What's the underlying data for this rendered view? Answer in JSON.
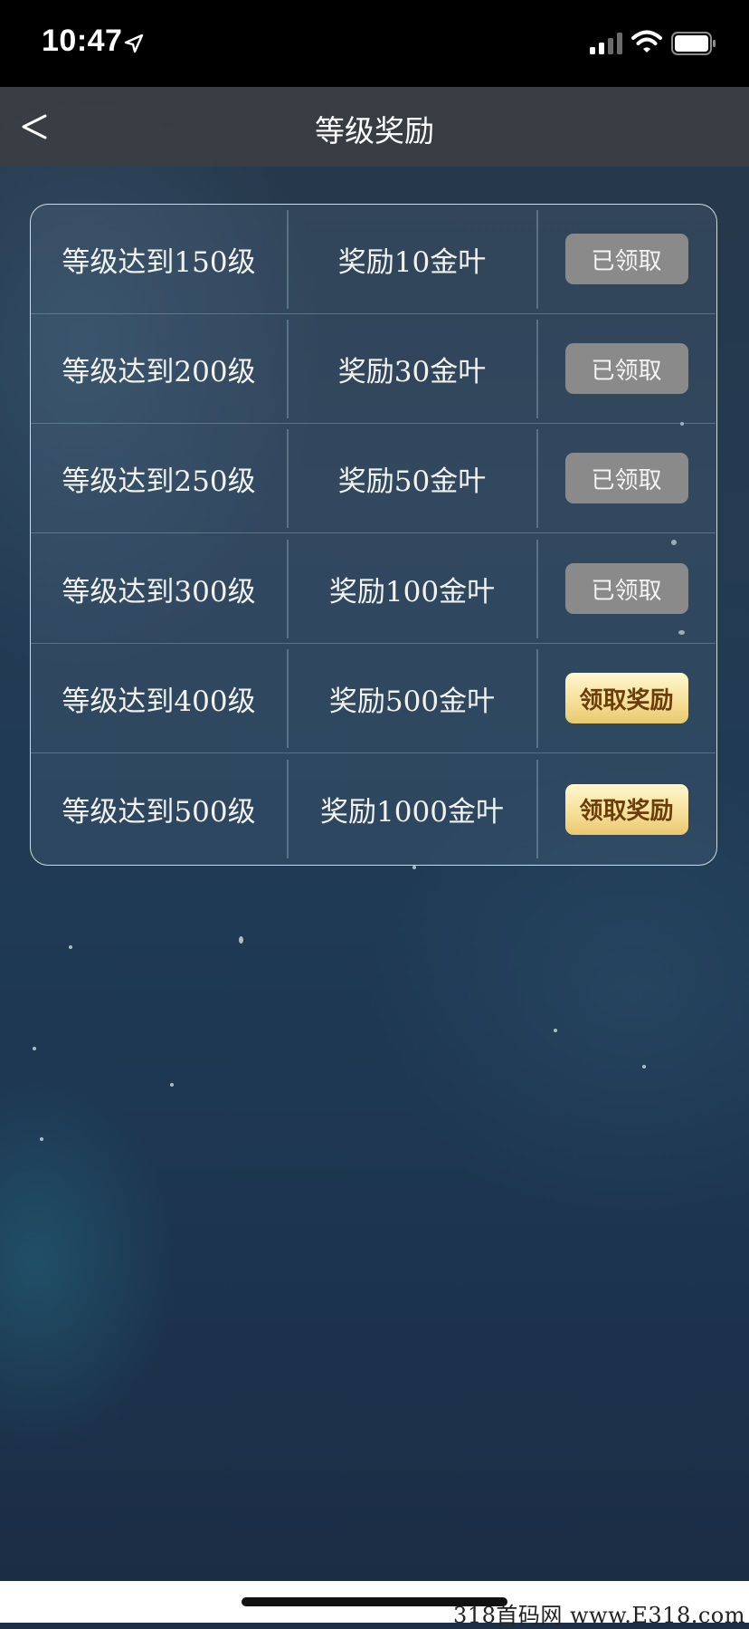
{
  "status_bar": {
    "time": "10:47"
  },
  "nav": {
    "title": "等级奖励"
  },
  "rewards": [
    {
      "level": "等级达到150级",
      "reward": "奖励10金叶",
      "button": "已领取",
      "state": "claimed"
    },
    {
      "level": "等级达到200级",
      "reward": "奖励30金叶",
      "button": "已领取",
      "state": "claimed"
    },
    {
      "level": "等级达到250级",
      "reward": "奖励50金叶",
      "button": "已领取",
      "state": "claimed"
    },
    {
      "level": "等级达到300级",
      "reward": "奖励100金叶",
      "button": "已领取",
      "state": "claimed"
    },
    {
      "level": "等级达到400级",
      "reward": "奖励500金叶",
      "button": "领取奖励",
      "state": "available"
    },
    {
      "level": "等级达到500级",
      "reward": "奖励1000金叶",
      "button": "领取奖励",
      "state": "available"
    }
  ],
  "watermark": "318首码网 www.E318.com",
  "colors": {
    "claimed_button": "#8a8a8a",
    "claim_button": "#f6e09a",
    "claim_button_text": "#6b3d0a"
  },
  "icons": {
    "back": "chevron-left-icon",
    "location": "location-arrow-icon",
    "signal": "cellular-signal-icon",
    "wifi": "wifi-icon",
    "battery": "battery-icon"
  }
}
